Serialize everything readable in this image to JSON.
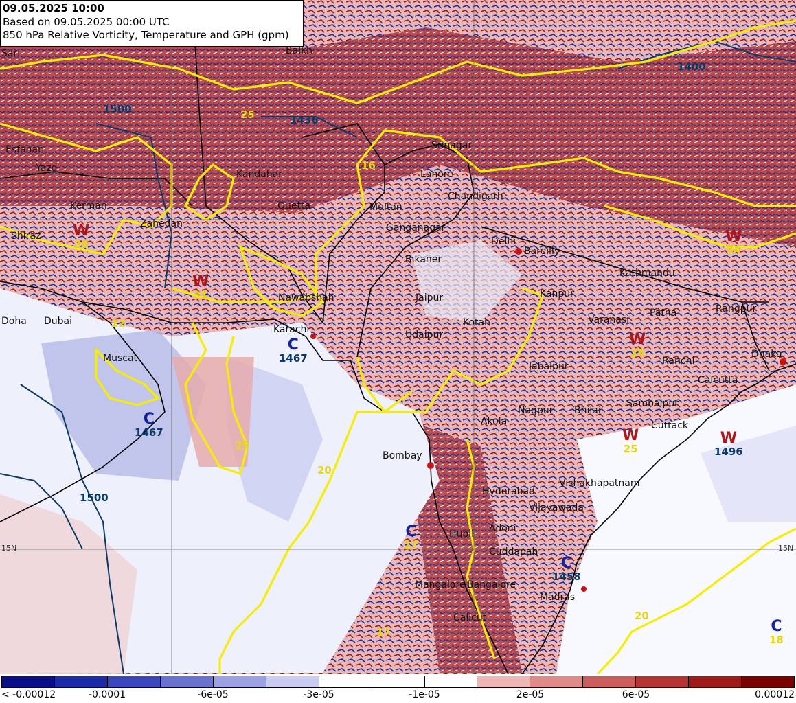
{
  "header": {
    "valid_time": "09.05.2025 10:00",
    "based_on": "Based on 09.05.2025 00:00 UTC",
    "parameter": "850 hPa Relative Vorticity, Temperature and GPH (gpm)"
  },
  "cities": {
    "sari": "Sari",
    "balkh": "Balkh",
    "esfahan": "Esfahan",
    "yazd": "Yazd",
    "kerman": "Kerman",
    "zahedan": "Zahedan",
    "shiraz": "Shiraz",
    "kandahar": "Kandahar",
    "quetta": "Quetta",
    "multan": "Multan",
    "lahore": "Lahore",
    "srinagar": "Srinagar",
    "chandigarh": "Chandigarh",
    "ganganagar": "Ganganagar",
    "delhi": "Delhi",
    "bareilly": "Bareilly",
    "bikaner": "Bikaner",
    "jaipur": "Jaipur",
    "kanpur": "Kanpur",
    "kotah": "Kotah",
    "udaipur": "Udaipur",
    "nawabshah": "Nawabshah",
    "karachi": "Karachi",
    "doha": "Doha",
    "dubai": "Dubai",
    "muscat": "Muscat",
    "kathmandu": "Kathmandu",
    "patna": "Patna",
    "varanasi": "Varanasi",
    "rangpur": "Rangpur",
    "dhaka": "Dhaka",
    "ranchi": "Ranchi",
    "calcutta": "Calcutta",
    "jabalpur": "Jabalpur",
    "sambalpur": "Sambalpur",
    "cuttack": "Cuttack",
    "nagpur": "Nagpur",
    "bhilai": "Bhilai",
    "akola": "Akola",
    "bombay": "Bombay",
    "hyderabad": "Hyderabad",
    "vishakhapatnam": "Vishakhapatnam",
    "vijayawada": "Vijayawada",
    "adoni": "Adoni",
    "hubli": "Hubli",
    "cuddapah": "Cuddapah",
    "mangalore": "Mangalore",
    "bangalore": "Bangalore",
    "madras": "Madras",
    "calicut": "Calicut"
  },
  "systems": [
    {
      "type": "W",
      "value": "1496"
    },
    {
      "type": "C",
      "value": "1467"
    },
    {
      "type": "C",
      "value": "1467"
    },
    {
      "type": "C",
      "value": "1458"
    },
    {
      "type": "C",
      "value": "18"
    },
    {
      "type": "C",
      "value": "17"
    },
    {
      "type": "W",
      "value": "25"
    },
    {
      "type": "W",
      "value": "25"
    },
    {
      "type": "W",
      "value": "34"
    },
    {
      "type": "W",
      "value": "31"
    },
    {
      "type": "W",
      "value": "28"
    }
  ],
  "contour_labels": {
    "gph": [
      "1436",
      "1400",
      "1500",
      "1500"
    ],
    "temp": [
      "25",
      "20",
      "20",
      "25",
      "22",
      "16",
      "17"
    ]
  },
  "lat_labels": [
    "15N",
    "15N"
  ],
  "colorbar": {
    "colors": [
      "#0a0f88",
      "#1c2aa8",
      "#3b47bd",
      "#6a72cf",
      "#9ca1e3",
      "#c9cbf1",
      "#ffffff",
      "#ffffff",
      "#ffffff",
      "#efb6b6",
      "#e08a8a",
      "#cc5c5c",
      "#b83434",
      "#a01818",
      "#7a0000"
    ],
    "labels": [
      "< -0.00012",
      "-0.0001",
      "-6e-05",
      "-3e-05",
      "-1e-05",
      "2e-05",
      "6e-05",
      "0.00012"
    ]
  }
}
